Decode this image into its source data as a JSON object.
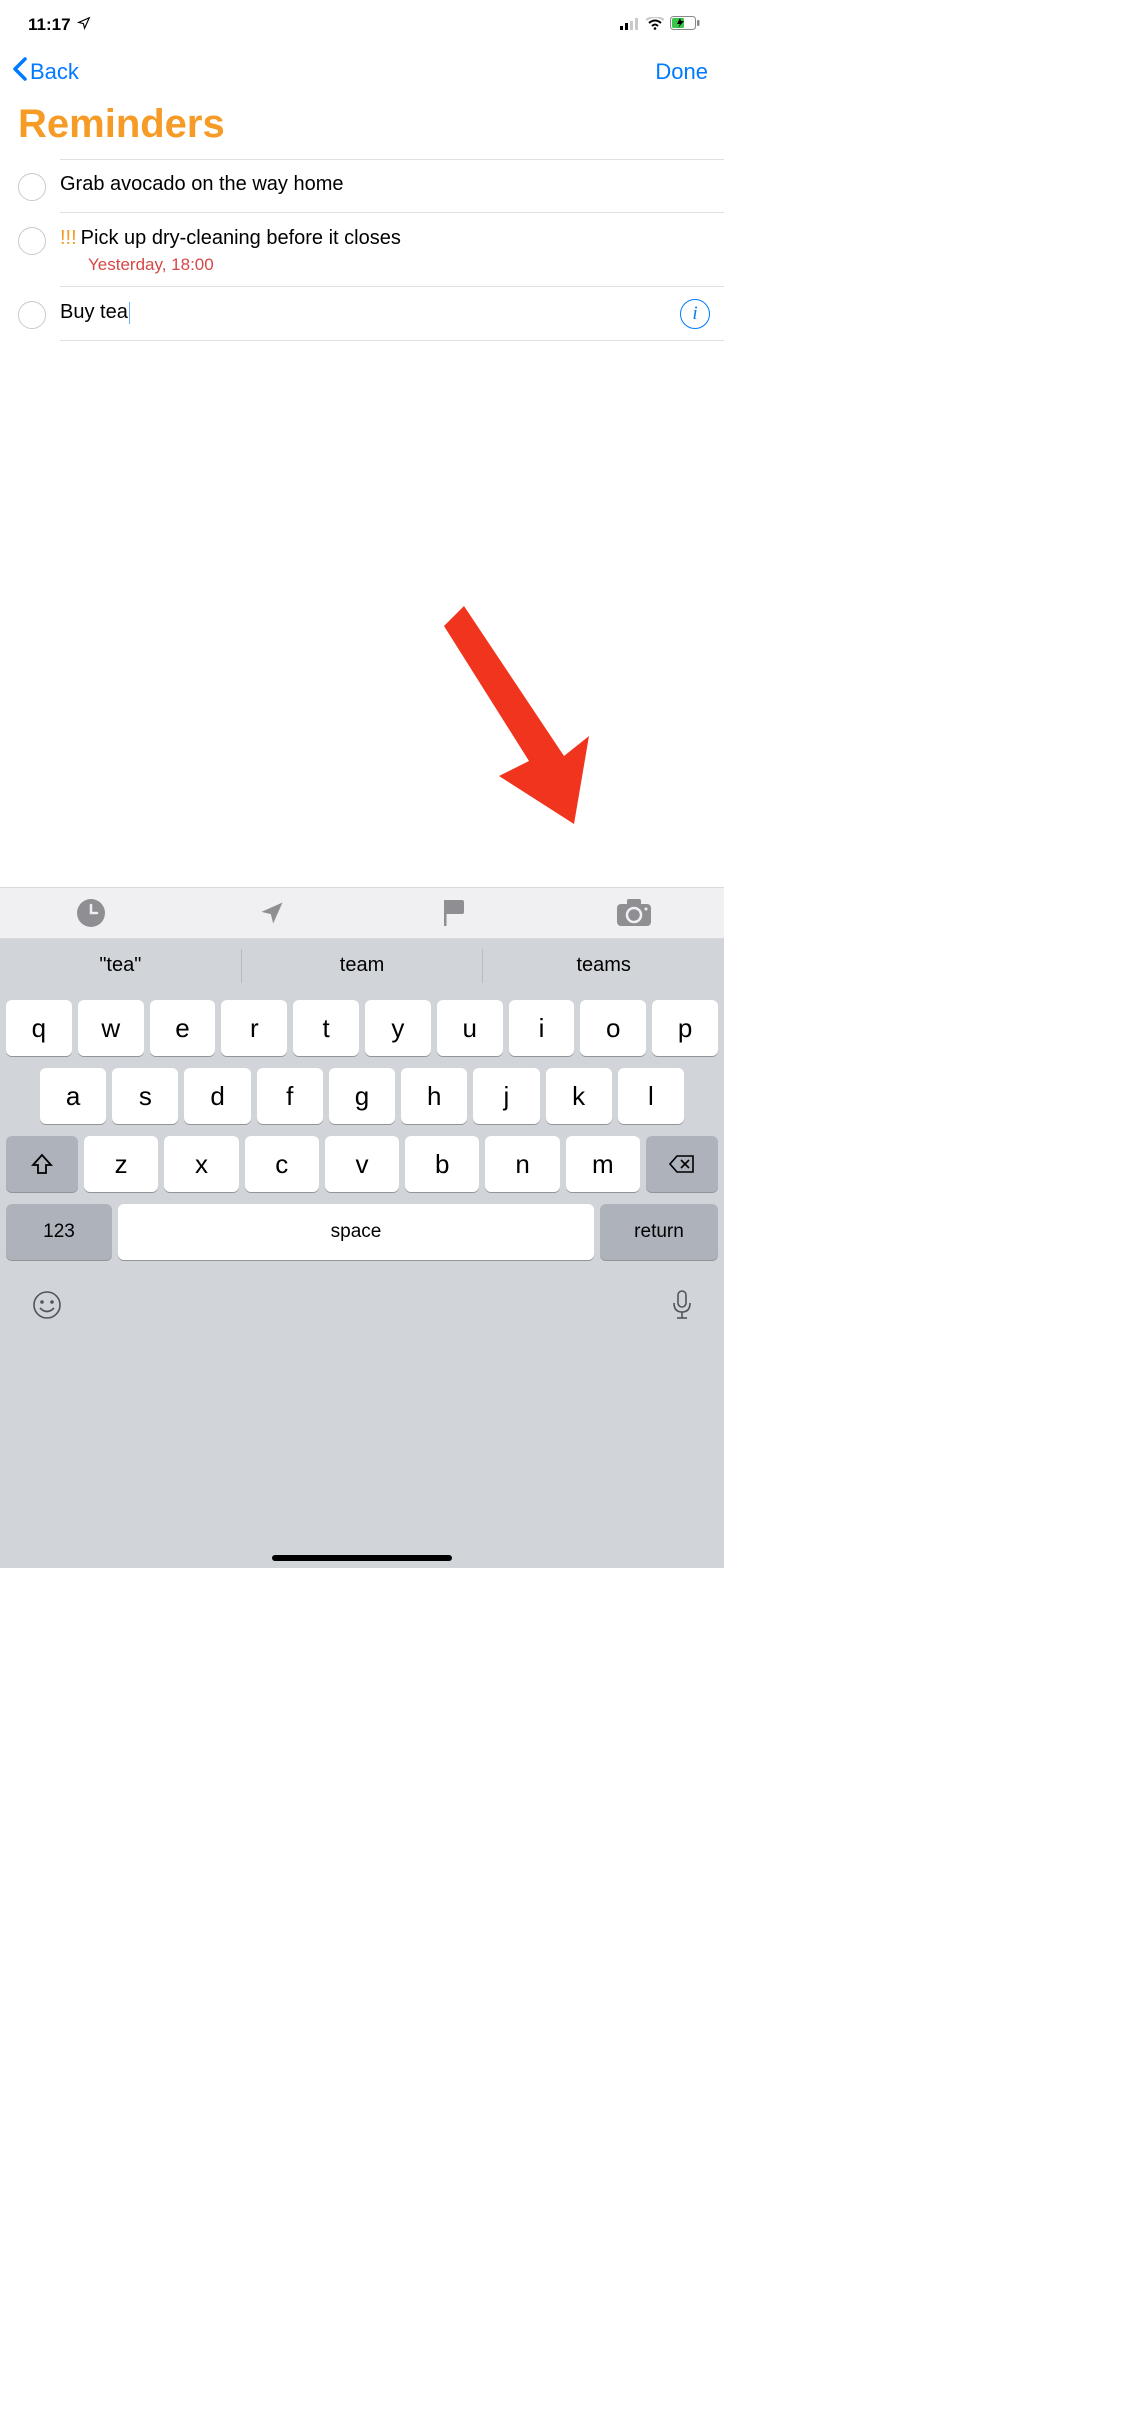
{
  "status": {
    "time": "11:17",
    "location_icon": "location-arrow-icon",
    "signal_icon": "cell-signal-icon",
    "wifi_icon": "wifi-icon",
    "battery_icon": "battery-charging-icon"
  },
  "nav": {
    "back_label": "Back",
    "done_label": "Done"
  },
  "title": "Reminders",
  "reminders": [
    {
      "text": "Grab avocado on the way home",
      "priority": "",
      "subtext": "",
      "editing": false,
      "info": false
    },
    {
      "text": "Pick up dry-cleaning before it closes",
      "priority": "!!!",
      "subtext": "Yesterday, 18:00",
      "editing": false,
      "info": false
    },
    {
      "text": "Buy tea",
      "priority": "",
      "subtext": "",
      "editing": true,
      "info": true
    }
  ],
  "quick_actions": {
    "clock": "clock-icon",
    "location": "location-arrow-icon",
    "flag": "flag-icon",
    "camera": "camera-icon"
  },
  "suggestions": [
    "\"tea\"",
    "team",
    "teams"
  ],
  "keyboard": {
    "row1": [
      "q",
      "w",
      "e",
      "r",
      "t",
      "y",
      "u",
      "i",
      "o",
      "p"
    ],
    "row2": [
      "a",
      "s",
      "d",
      "f",
      "g",
      "h",
      "j",
      "k",
      "l"
    ],
    "row3": [
      "z",
      "x",
      "c",
      "v",
      "b",
      "n",
      "m"
    ],
    "num_label": "123",
    "space_label": "space",
    "return_label": "return",
    "emoji_icon": "emoji-icon",
    "mic_icon": "mic-icon"
  },
  "overlay": {
    "arrow": "red-arrow-annotation"
  }
}
